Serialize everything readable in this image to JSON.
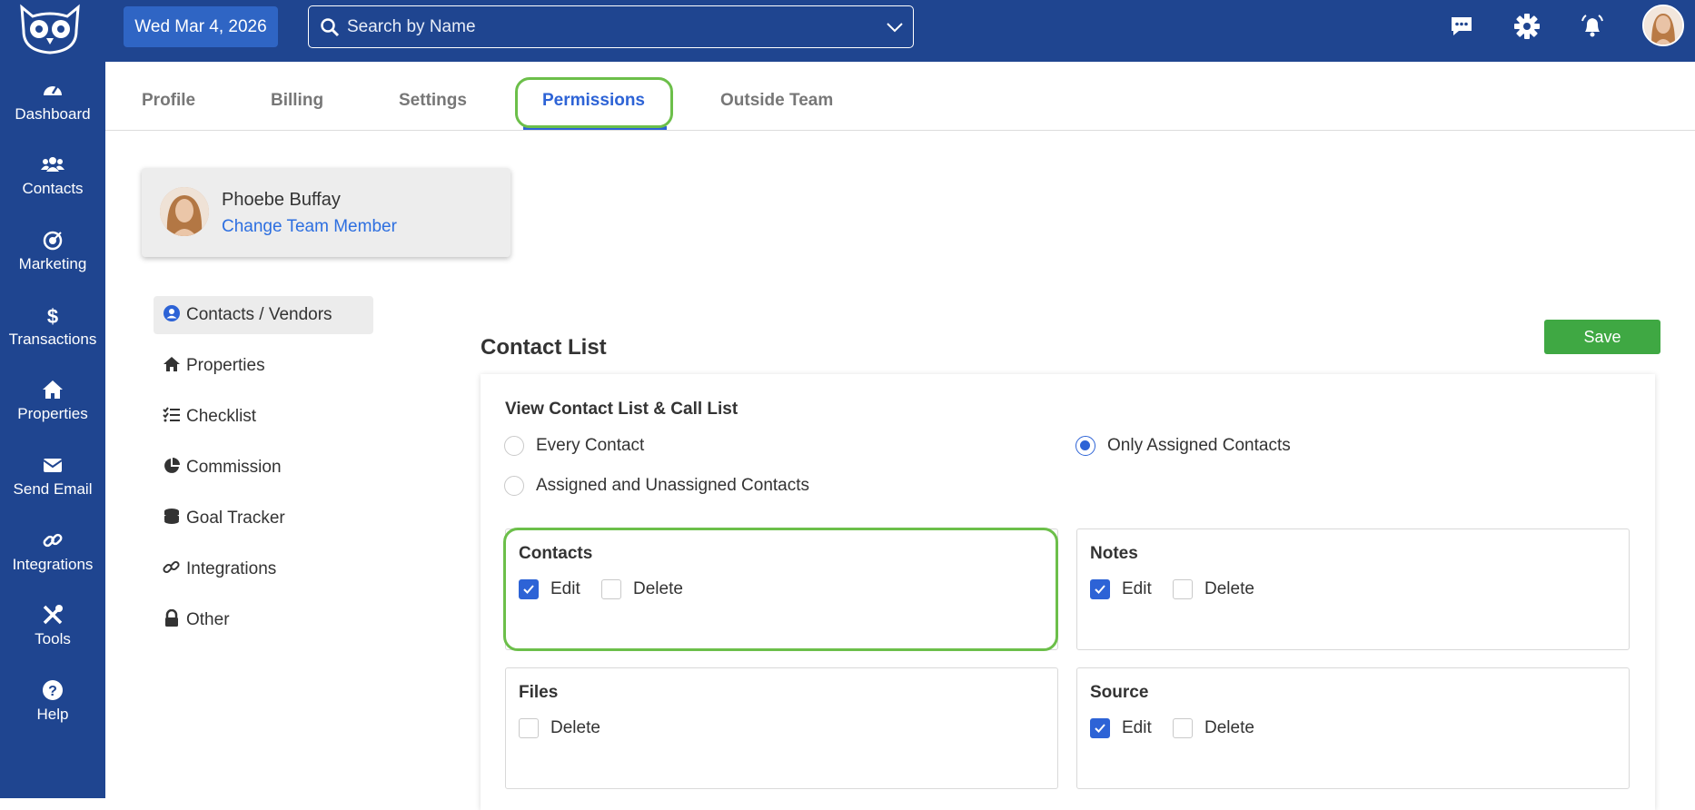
{
  "sidebar": {
    "items": [
      {
        "label": "Dashboard",
        "icon": "dashboard-gauge-icon"
      },
      {
        "label": "Contacts",
        "icon": "users-icon"
      },
      {
        "label": "Marketing",
        "icon": "target-icon"
      },
      {
        "label": "Transactions",
        "icon": "dollar-icon"
      },
      {
        "label": "Properties",
        "icon": "home-icon"
      },
      {
        "label": "Send Email",
        "icon": "envelope-icon"
      },
      {
        "label": "Integrations",
        "icon": "link-icon"
      },
      {
        "label": "Tools",
        "icon": "tools-icon"
      },
      {
        "label": "Help",
        "icon": "question-icon"
      }
    ]
  },
  "topbar": {
    "date": "Wed Mar 4, 2026",
    "search_placeholder": "Search by Name",
    "icons": [
      "chat-icon",
      "gear-icon",
      "bell-icon",
      "user-avatar"
    ]
  },
  "tabs": [
    {
      "label": "Profile"
    },
    {
      "label": "Billing"
    },
    {
      "label": "Settings"
    },
    {
      "label": "Permissions",
      "active": true
    },
    {
      "label": "Outside Team"
    }
  ],
  "member": {
    "name": "Phoebe Buffay",
    "change_link": "Change Team Member"
  },
  "permission_menu": [
    {
      "label": "Contacts / Vendors",
      "icon": "user-circle-icon",
      "active": true
    },
    {
      "label": "Properties",
      "icon": "home-icon"
    },
    {
      "label": "Checklist",
      "icon": "checklist-icon"
    },
    {
      "label": "Commission",
      "icon": "pie-chart-icon"
    },
    {
      "label": "Goal Tracker",
      "icon": "coins-icon"
    },
    {
      "label": "Integrations",
      "icon": "link-icon"
    },
    {
      "label": "Other",
      "icon": "lock-icon"
    }
  ],
  "content": {
    "title": "Contact List",
    "save_label": "Save",
    "view_label": "View Contact List & Call List",
    "view_options": [
      {
        "label": "Every Contact",
        "checked": false
      },
      {
        "label": "Only Assigned Contacts",
        "checked": true
      },
      {
        "label": "Assigned and Unassigned Contacts",
        "checked": false
      }
    ],
    "boxes": [
      {
        "title": "Contacts",
        "options": [
          {
            "label": "Edit",
            "checked": true
          },
          {
            "label": "Delete",
            "checked": false
          }
        ]
      },
      {
        "title": "Notes",
        "options": [
          {
            "label": "Edit",
            "checked": true
          },
          {
            "label": "Delete",
            "checked": false
          }
        ]
      },
      {
        "title": "Files",
        "options": [
          {
            "label": "Delete",
            "checked": false
          }
        ]
      },
      {
        "title": "Source",
        "options": [
          {
            "label": "Edit",
            "checked": true
          },
          {
            "label": "Delete",
            "checked": false
          }
        ]
      }
    ]
  },
  "colors": {
    "sidebar": "#1f4590",
    "accent": "#2d63d6",
    "save": "#3fa843",
    "highlight": "#6cbf4a"
  }
}
